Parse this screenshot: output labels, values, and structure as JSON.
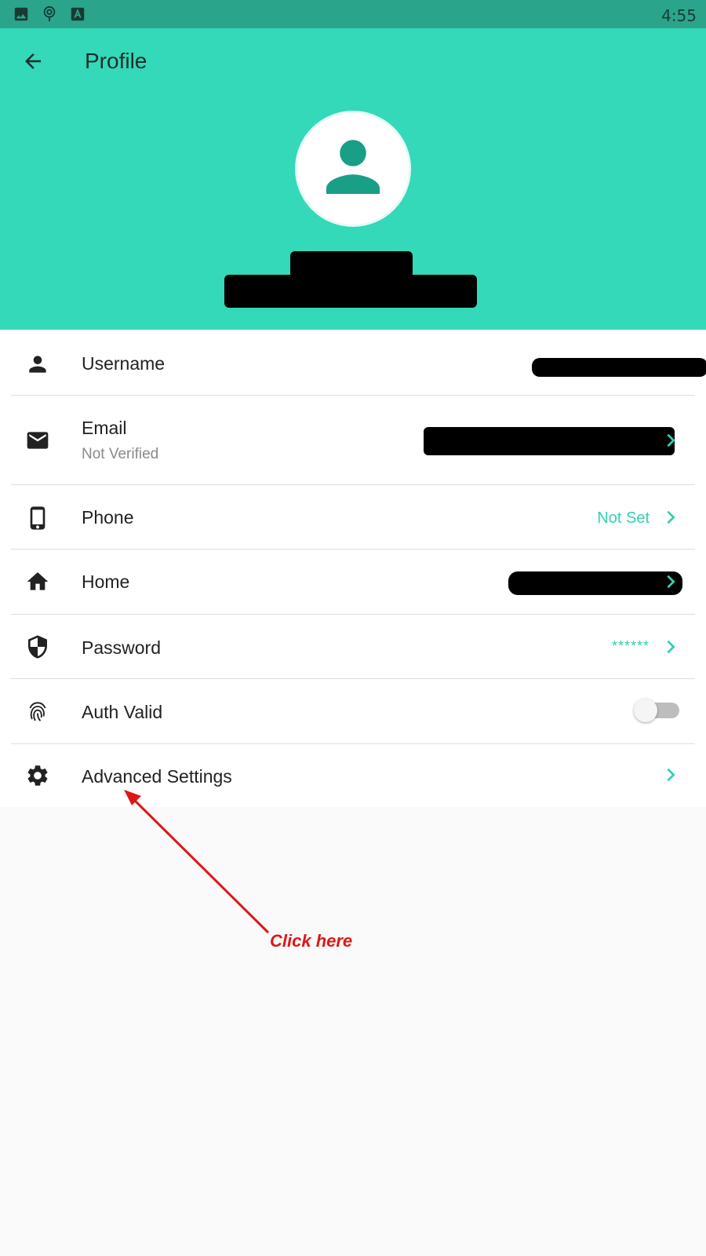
{
  "status_bar": {
    "time": "4:55",
    "icons": [
      "image-icon",
      "location-pin-icon",
      "font-a-icon"
    ]
  },
  "header": {
    "title": "Profile",
    "back_icon": "arrow-left-icon",
    "avatar_icon": "person-icon",
    "colors": {
      "header_bg": "#33d9b8",
      "status_bg": "#2aa58c",
      "avatar_fg": "#189f86"
    }
  },
  "rows": [
    {
      "icon": "person-icon",
      "label": "Username",
      "value_redacted": true
    },
    {
      "icon": "envelope-icon",
      "label": "Email",
      "sublabel": "Not Verified",
      "value_redacted": true,
      "chevron": true
    },
    {
      "icon": "phone-icon",
      "label": "Phone",
      "value": "Not Set",
      "chevron": true
    },
    {
      "icon": "home-icon",
      "label": "Home",
      "value_redacted": true,
      "chevron": true
    },
    {
      "icon": "shield-icon",
      "label": "Password",
      "value": "******",
      "chevron": true
    },
    {
      "icon": "fingerprint-icon",
      "label": "Auth Valid",
      "toggle": "off"
    },
    {
      "icon": "gear-icon",
      "label": "Advanced Settings",
      "chevron": true
    }
  ],
  "annotation": {
    "text": "Click here",
    "color": "#e01616"
  },
  "accent_color": "#33d0b0"
}
